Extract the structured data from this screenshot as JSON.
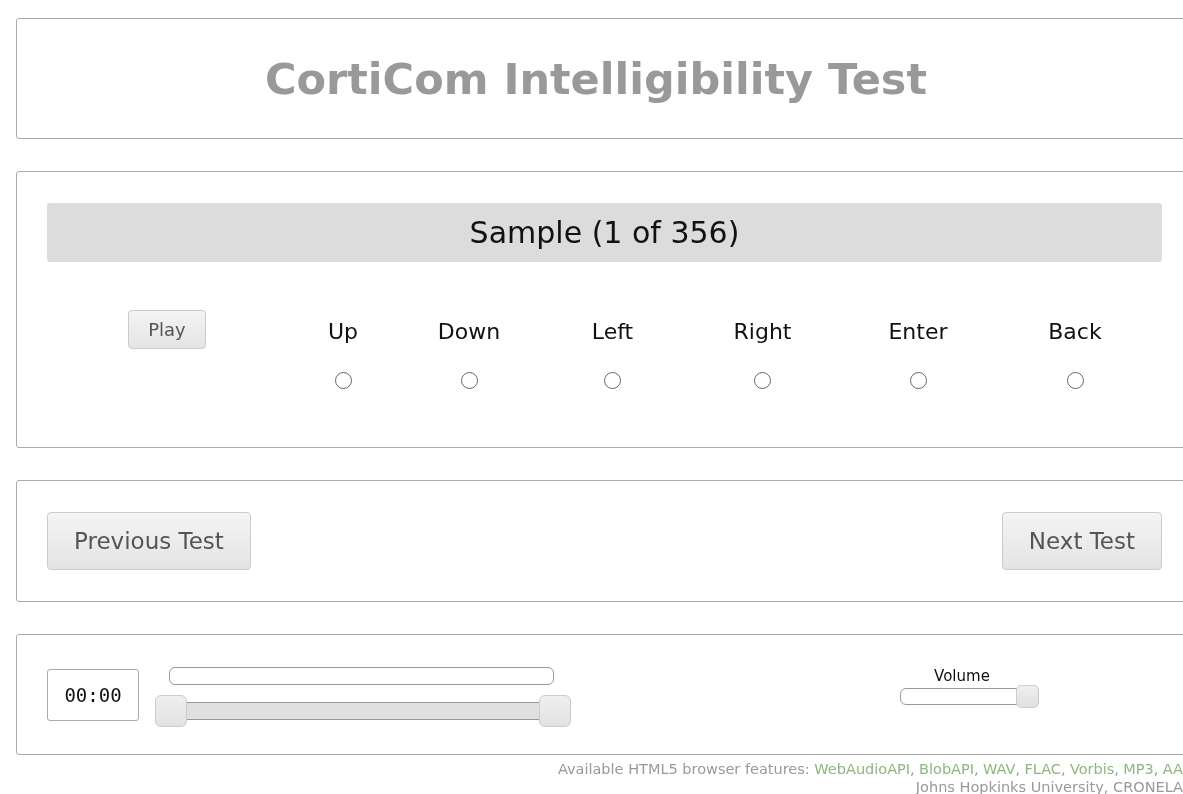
{
  "title": "CortiCom Intelligibility Test",
  "sample": {
    "heading": "Sample (1 of 356)",
    "play_button": "Play",
    "options": [
      {
        "label": "Up",
        "selected": false
      },
      {
        "label": "Down",
        "selected": false
      },
      {
        "label": "Left",
        "selected": false
      },
      {
        "label": "Right",
        "selected": false
      },
      {
        "label": "Enter",
        "selected": false
      },
      {
        "label": "Back",
        "selected": false
      }
    ]
  },
  "navigation": {
    "previous_button": "Previous Test",
    "next_button": "Next Test"
  },
  "player": {
    "time": "00:00",
    "progress": {
      "level": 0
    },
    "range_start": {
      "level": 0
    },
    "range_end": {
      "level": 1
    },
    "volume_label": "Volume",
    "volume": {
      "level": 1
    }
  },
  "footer": {
    "features_label": "Available HTML5 browser features:",
    "features": [
      {
        "name": "WebAudioAPI",
        "separator": ","
      },
      {
        "name": "BlobAPI",
        "separator": ","
      },
      {
        "name": "WAV",
        "separator": ","
      },
      {
        "name": "FLAC",
        "separator": ","
      },
      {
        "name": "Vorbis",
        "separator": ","
      },
      {
        "name": "MP3",
        "separator": ","
      },
      {
        "name": "AA"
      }
    ],
    "credit": "Johns Hopkinks University, CRONELA"
  }
}
